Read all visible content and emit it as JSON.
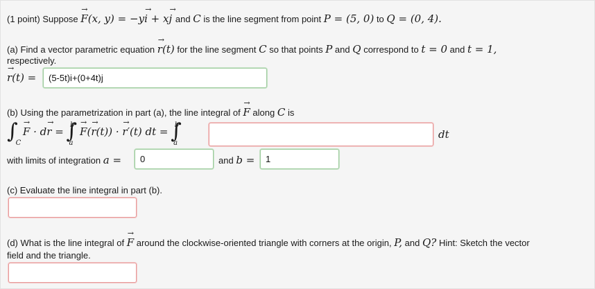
{
  "header": {
    "points": "(1 point)",
    "suppose": "Suppose",
    "F_def": "F(x, y) = −yi + xj",
    "and": "and",
    "C": "C",
    "is_segment": "is the line segment from point",
    "P_def": "P = (5, 0)",
    "to": "to",
    "Q_def": "Q = (0, 4)."
  },
  "part_a": {
    "text1": "(a) Find a vector parametric equation",
    "rt": "r(t)",
    "text2": "for the line segment",
    "text3": "so that points",
    "P": "P",
    "and": "and",
    "Q": "Q",
    "text4": "correspond to",
    "t0": "t = 0",
    "and2": "and",
    "t1": "t = 1,",
    "text5": "respectively.",
    "lhs": "r(t) =",
    "answer": "(5-5t)i+(0+4t)j"
  },
  "part_b": {
    "text1": "(b) Using the parametrization in part (a), the line integral of",
    "F": "F",
    "text2": "along",
    "C": "C",
    "is": "is",
    "sub_C": "C",
    "Fdr": "F · dr =",
    "lim_b": "b",
    "lim_a": "a",
    "integrand": "F(r(t)) · r′(t) dt =",
    "dt": "dt",
    "integrand_answer": "",
    "limits_text": "with limits of integration",
    "a_eq": "a =",
    "a_value": "0",
    "and": "and",
    "b_eq": "b =",
    "b_value": "1"
  },
  "part_c": {
    "text": "(c) Evaluate the line integral in part (b).",
    "answer": ""
  },
  "part_d": {
    "text1": "(d) What is the line integral of",
    "F": "F",
    "text2": "around the clockwise-oriented triangle with corners at the origin,",
    "P": "P,",
    "and": "and",
    "Q": "Q?",
    "text3": "Hint: Sketch the vector",
    "text4": "field and the triangle.",
    "answer": ""
  },
  "colors": {
    "correct_border": "#9ecb9e",
    "incorrect_border": "#e79a9a",
    "background": "#f5f5f5"
  }
}
